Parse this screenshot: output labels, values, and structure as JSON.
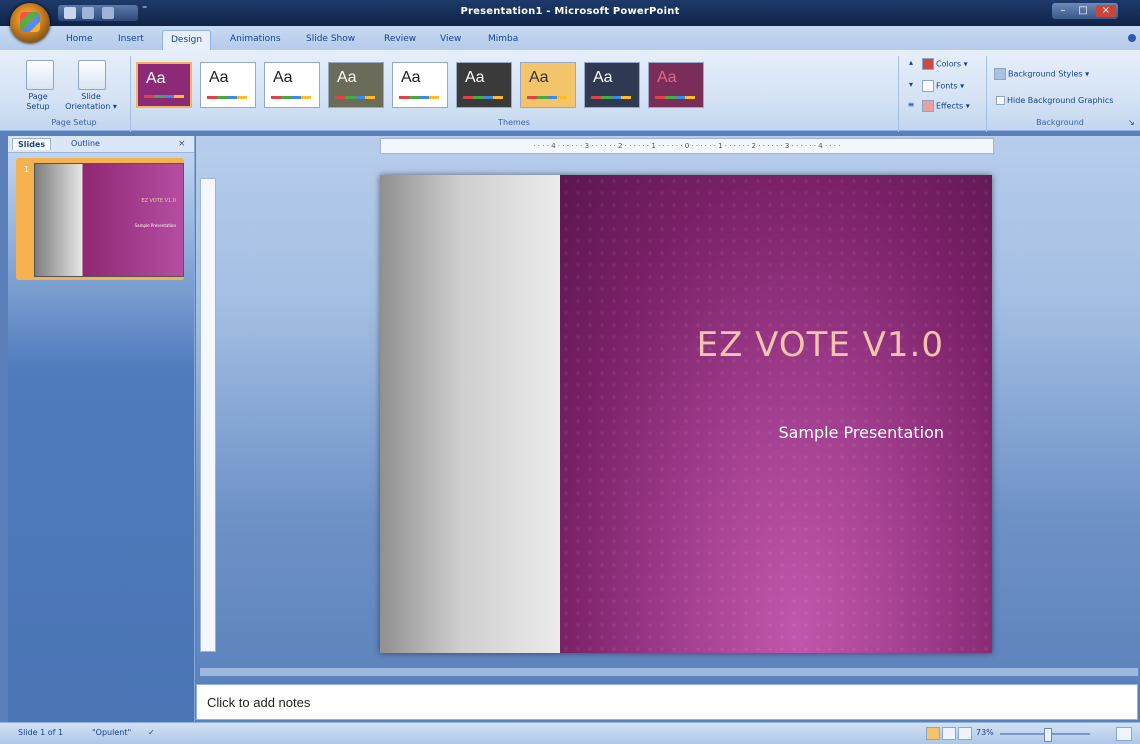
{
  "window": {
    "title": "Presentation1 - Microsoft PowerPoint",
    "qat_more": "⁼"
  },
  "ribbon": {
    "tabs": [
      "Home",
      "Insert",
      "Design",
      "Animations",
      "Slide Show",
      "Review",
      "View",
      "Mimba"
    ],
    "active_tab": "Design",
    "page_setup": {
      "page_setup_label": "Page Setup",
      "slide_orientation_label": "Slide Orientation ▾",
      "group_label": "Page Setup"
    },
    "themes": {
      "group_label": "Themes",
      "items": [
        {
          "glyph": "Aa",
          "bg": "#8c2a78",
          "fg": "#ffffff"
        },
        {
          "glyph": "Aa",
          "bg": "#ffffff",
          "fg": "#222222"
        },
        {
          "glyph": "Aa",
          "bg": "#ffffff",
          "fg": "#222222"
        },
        {
          "glyph": "Aa",
          "bg": "#6b6b5a",
          "fg": "#ffffff"
        },
        {
          "glyph": "Aa",
          "bg": "#ffffff",
          "fg": "#222222"
        },
        {
          "glyph": "Aa",
          "bg": "#3a3a3a",
          "fg": "#ffffff"
        },
        {
          "glyph": "Aa",
          "bg": "#f3c46a",
          "fg": "#333333"
        },
        {
          "glyph": "Aa",
          "bg": "#2f3a52",
          "fg": "#ffffff"
        },
        {
          "glyph": "Aa",
          "bg": "#7a2d58",
          "fg": "#e06a8a"
        }
      ]
    },
    "theme_options": {
      "colors": "Colors ▾",
      "fonts": "Fonts ▾",
      "effects": "Effects ▾"
    },
    "background": {
      "styles": "Background Styles ▾",
      "hide_graphics": "Hide Background Graphics",
      "group_label": "Background"
    }
  },
  "left_panel": {
    "tabs": [
      "Slides",
      "Outline"
    ],
    "active_tab": "Slides",
    "close": "×",
    "slide_number": "1",
    "thumb_title": "EZ VOTE V1.0",
    "thumb_subtitle": "Sample Presentation"
  },
  "slide": {
    "title": "EZ VOTE V1.0",
    "subtitle": "Sample Presentation"
  },
  "notes": {
    "placeholder": "Click to add notes"
  },
  "status_bar": {
    "slide_info": "Slide 1 of 1",
    "theme_name": "\"Opulent\"",
    "zoom": "73%"
  },
  "ruler": {
    "marks": "· · · · 4 · · · · · · 3 · · · · · · 2 · · · · · · 1 · · · · · · 0 · · · · · · 1 · · · · · · 2 · · · · · · 3 · · · · · · 4 · · · ·"
  },
  "colors": {
    "accent": "#8f2773",
    "ribbon": "#d5e3f5",
    "workspace": "#6e91c6"
  }
}
